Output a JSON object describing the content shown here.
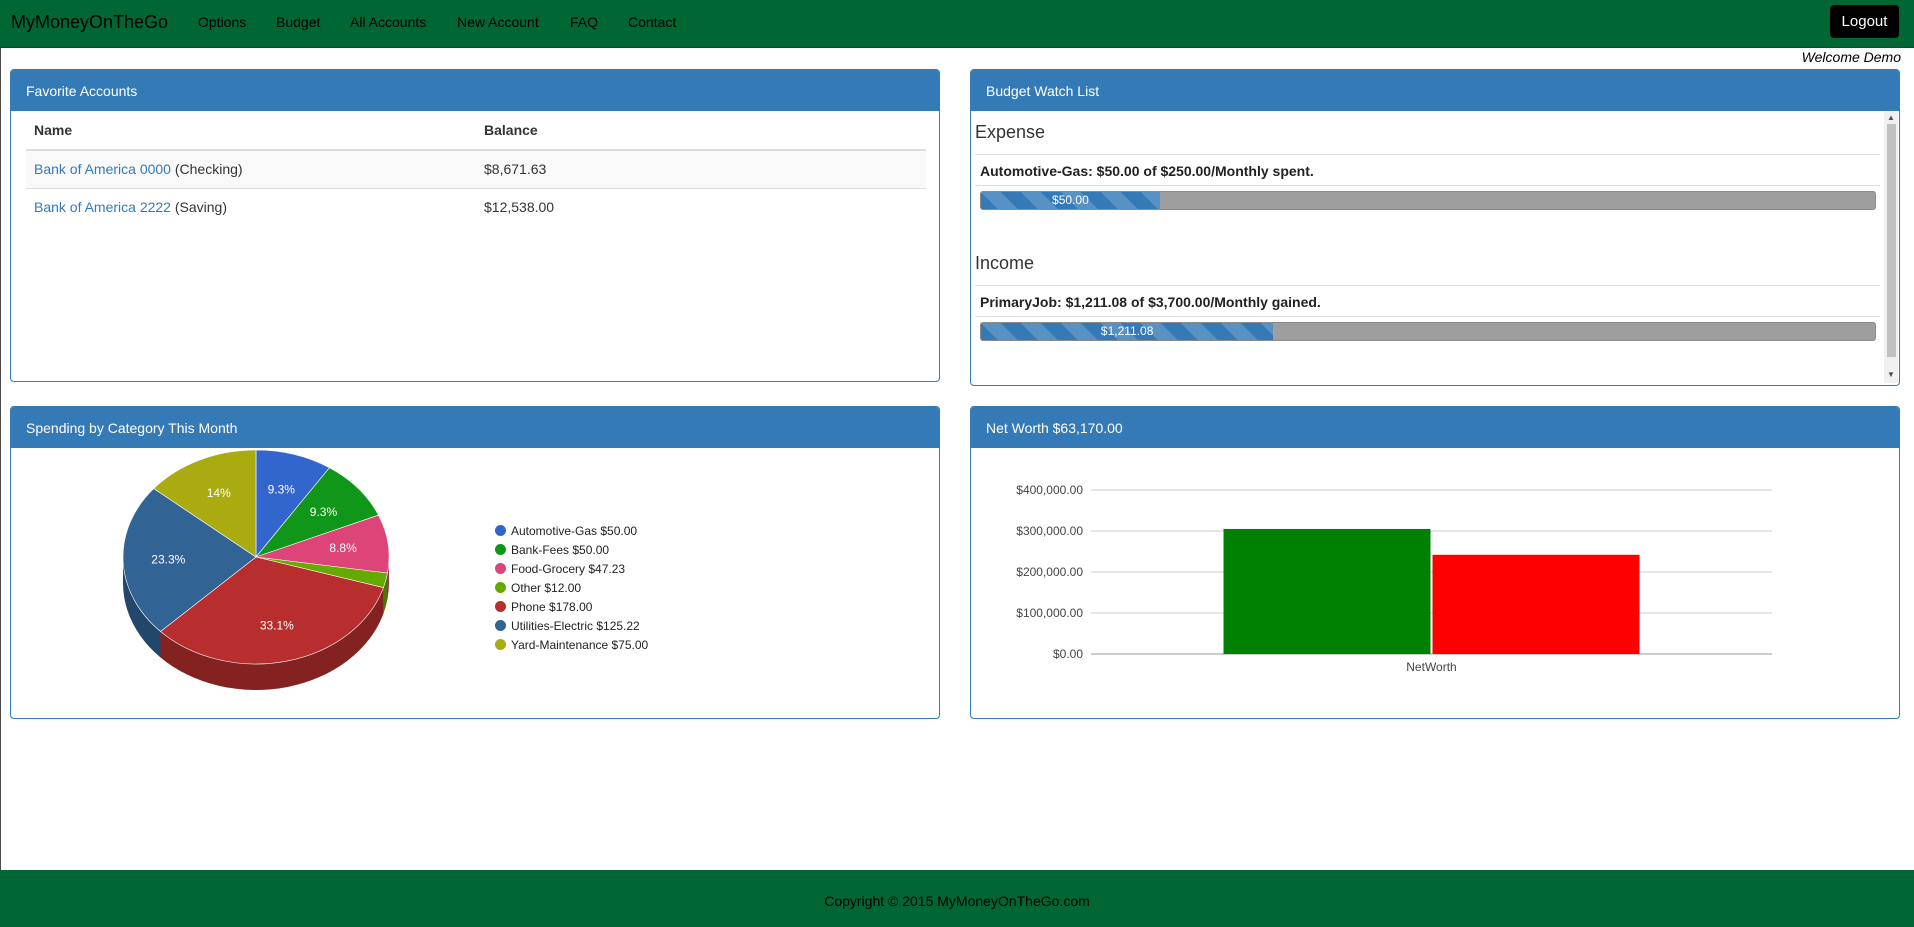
{
  "nav": {
    "brand": "MyMoneyOnTheGo",
    "items": [
      "Options",
      "Budget",
      "All Accounts",
      "New Account",
      "FAQ",
      "Contact"
    ],
    "logout": "Logout"
  },
  "welcome": "Welcome Demo",
  "favorites": {
    "title": "Favorite Accounts",
    "columns": [
      "Name",
      "Balance"
    ],
    "rows": [
      {
        "name": "Bank of America 0000",
        "type": "(Checking)",
        "balance": "$8,671.63"
      },
      {
        "name": "Bank of America 2222",
        "type": "(Saving)",
        "balance": "$12,538.00"
      }
    ]
  },
  "budget": {
    "title": "Budget Watch List",
    "expense_title": "Expense",
    "expense_line": "Automotive-Gas: $50.00 of $250.00/Monthly spent.",
    "expense_bar_label": "$50.00",
    "expense_fraction": 0.2,
    "income_title": "Income",
    "income_line": "PrimaryJob: $1,211.08 of $3,700.00/Monthly gained.",
    "income_bar_label": "$1,211.08",
    "income_fraction": 0.327
  },
  "spending": {
    "title": "Spending by Category This Month"
  },
  "networth": {
    "title": "Net Worth $63,170.00"
  },
  "footer": "Copyright © 2015 MyMoneyOnTheGo.com",
  "chart_data": [
    {
      "type": "pie",
      "title": "",
      "slices": [
        {
          "label": "Automotive-Gas $50.00",
          "value": 50.0,
          "pct_label": "9.3%",
          "color": "#3366cc"
        },
        {
          "label": "Bank-Fees $50.00",
          "value": 50.0,
          "pct_label": "9.3%",
          "color": "#109618"
        },
        {
          "label": "Food-Grocery $47.23",
          "value": 47.23,
          "pct_label": "8.8%",
          "color": "#dd4477"
        },
        {
          "label": "Other $12.00",
          "value": 12.0,
          "pct_label": "",
          "color": "#66aa00"
        },
        {
          "label": "Phone $178.00",
          "value": 178.0,
          "pct_label": "33.1%",
          "color": "#b82e2e"
        },
        {
          "label": "Utilities-Electric $125.22",
          "value": 125.22,
          "pct_label": "23.3%",
          "color": "#316395"
        },
        {
          "label": "Yard-Maintenance $75.00",
          "value": 75.0,
          "pct_label": "14%",
          "color": "#aaaa11"
        }
      ],
      "legend": "right"
    },
    {
      "type": "bar",
      "title": "",
      "categories": [
        "NetWorth"
      ],
      "series": [
        {
          "values": [
            305000
          ],
          "color": "#008000"
        },
        {
          "values": [
            242000
          ],
          "color": "#ff0000"
        }
      ],
      "ylim": [
        0,
        400000
      ],
      "yticks": [
        "$0.00",
        "$100,000.00",
        "$200,000.00",
        "$300,000.00",
        "$400,000.00"
      ],
      "ytick_values": [
        0,
        100000,
        200000,
        300000,
        400000
      ],
      "grid": true
    }
  ]
}
